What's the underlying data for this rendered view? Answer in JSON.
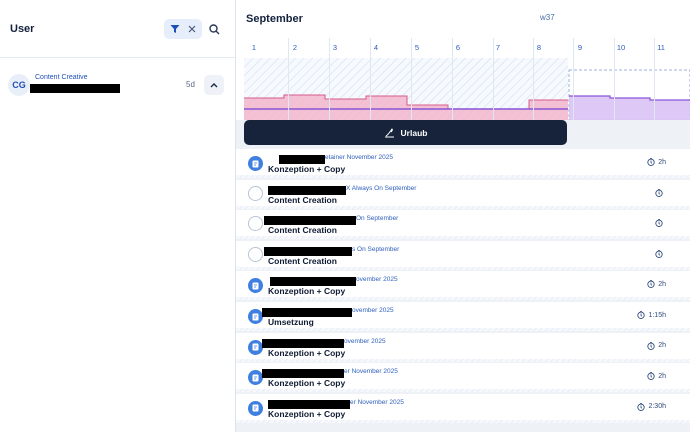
{
  "left": {
    "title": "User",
    "user": {
      "initials": "CG",
      "role": "Content Creative",
      "duration": "5d"
    }
  },
  "timeline": {
    "month": "September",
    "week": "w37",
    "days": [
      "1",
      "2",
      "3",
      "4",
      "5",
      "6",
      "7",
      "8",
      "9",
      "10",
      "11"
    ]
  },
  "urlaub_label": "Urlaub",
  "tasks": [
    {
      "project": "etainer November 2025",
      "name": "Konzeption + Copy",
      "time": "2h",
      "icon": "filled"
    },
    {
      "project": "X Always On September",
      "name": "Content Creation",
      "time": "",
      "icon": "empty"
    },
    {
      "project": "On September",
      "name": "Content Creation",
      "time": "",
      "icon": "empty"
    },
    {
      "project": "s On September",
      "name": "Content Creation",
      "time": "",
      "icon": "empty"
    },
    {
      "project": "ovember 2025",
      "name": "Konzeption + Copy",
      "time": "2h",
      "icon": "filled"
    },
    {
      "project": "ovember 2025",
      "name": "Umsetzung",
      "time": "1:15h",
      "icon": "filled"
    },
    {
      "project": "ovember 2025",
      "name": "Konzeption + Copy",
      "time": "2h",
      "icon": "filled"
    },
    {
      "project": "er November 2025",
      "name": "Konzeption + Copy",
      "time": "2h",
      "icon": "filled"
    },
    {
      "project": "er November 2025",
      "name": "Konzeption + Copy",
      "time": "2:30h",
      "icon": "filled"
    }
  ],
  "colors": {
    "accent": "#3f7fe0",
    "dark": "#16233a",
    "load_pink": "#f3b3c8",
    "load_purple": "#b48be8"
  }
}
